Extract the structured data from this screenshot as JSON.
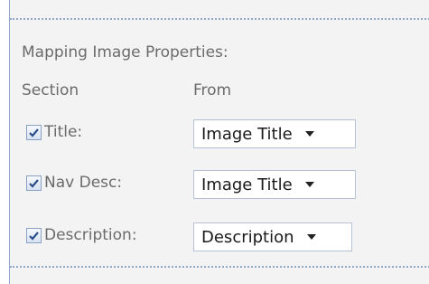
{
  "mapping": {
    "heading": "Mapping Image Properties:",
    "columns": {
      "section": "Section",
      "from": "From"
    },
    "rows": [
      {
        "label": "Title:",
        "checked": true,
        "value": "Image Title"
      },
      {
        "label": "Nav Desc:",
        "checked": true,
        "value": "Image Title"
      },
      {
        "label": "Description:",
        "checked": true,
        "value": "Description"
      }
    ]
  },
  "colors": {
    "panel_bg": "#f3f3f3",
    "border_accent": "#8fa8c9",
    "label_text": "#6b6b6b"
  }
}
